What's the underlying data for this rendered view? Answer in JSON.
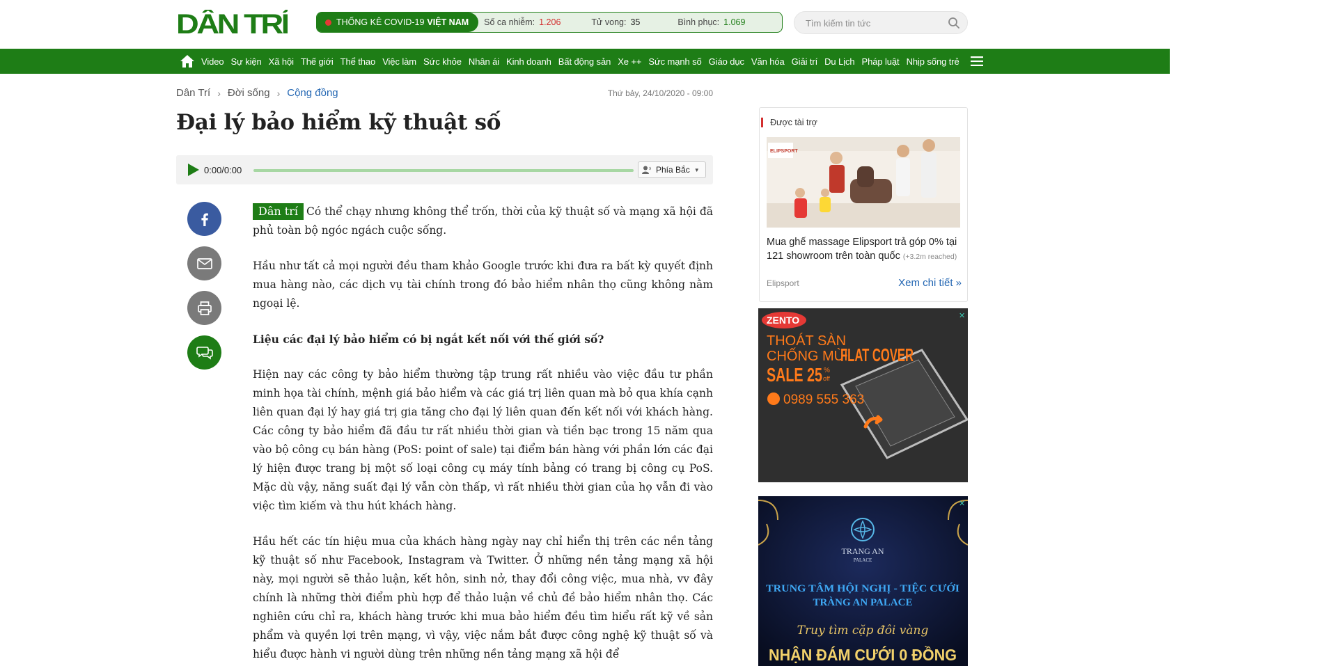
{
  "header": {
    "logo_text": "DÂN TRÍ",
    "covid": {
      "label": "THỐNG KÊ COVID-19",
      "country": "VIỆT NAM",
      "infected_label": "Số ca nhiễm:",
      "infected_value": "1.206",
      "deaths_label": "Tử vong:",
      "deaths_value": "35",
      "recovered_label": "Bình phục:",
      "recovered_value": "1.069",
      "infected_color": "#d32f2f",
      "recovered_color": "#1e7d16"
    },
    "search": {
      "placeholder": "Tìm kiếm tin tức"
    }
  },
  "nav": {
    "items": [
      "Video",
      "Sự kiện",
      "Xã hội",
      "Thế giới",
      "Thể thao",
      "Việc làm",
      "Sức khỏe",
      "Nhân ái",
      "Kinh doanh",
      "Bất động sản",
      "Xe ++",
      "Sức mạnh số",
      "Giáo dục",
      "Văn hóa",
      "Giải trí",
      "Du Lịch",
      "Pháp luật",
      "Nhịp sống trẻ"
    ],
    "bg_color": "#1e7d16"
  },
  "breadcrumb": [
    "Dân Trí",
    "Đời sống",
    "Cộng đồng"
  ],
  "date": "Thứ bảy, 24/10/2020 - 09:00",
  "title": "Đại lý bảo hiểm kỹ thuật số",
  "audio": {
    "time": "0:00/0:00",
    "voice": "Phía Bắc"
  },
  "share": {
    "icons": [
      "facebook-icon",
      "email-icon",
      "print-icon",
      "comment-icon"
    ]
  },
  "article": {
    "source_tag": "Dân trí",
    "lead": "Có thể chạy nhưng không thể trốn, thời của kỹ thuật số và mạng xã hội đã phủ toàn bộ ngóc ngách cuộc sống.",
    "p1": "Hầu như tất cả mọi người đều tham khảo Google trước khi đưa ra bất kỳ quyết định mua hàng nào, các dịch vụ tài chính trong đó bảo hiểm nhân thọ cũng không nằm ngoại lệ.",
    "subheading": "Liệu các đại lý bảo hiểm có bị ngắt kết nối với thế giới số?",
    "p2": "Hiện nay các công ty bảo hiểm thường tập trung rất nhiều vào việc đầu tư phần minh họa tài chính, mệnh giá bảo hiểm và các giá trị liên quan mà bỏ qua khía cạnh liên quan đại lý hay giá trị gia tăng cho đại lý liên quan đến kết nối với khách hàng. Các công ty bảo hiểm đã đầu tư rất nhiều thời gian và tiền bạc trong 15 năm qua vào bộ công cụ bán hàng (PoS: point of sale) tại điểm bán hàng với phần lớn các đại lý hiện được trang bị một số loại công cụ máy tính bảng có trang bị công cụ PoS. Mặc dù vậy, năng suất đại lý vẫn còn thấp, vì rất nhiều thời gian của họ vẫn đi vào việc tìm kiếm và thu hút khách hàng.",
    "p3": "Hầu hết các tín hiệu mua của khách hàng ngày nay chỉ hiển thị trên các nền tảng kỹ thuật số như Facebook, Instagram và Twitter. Ở những nền tảng mạng xã hội này, mọi người sẽ thảo luận, kết hôn, sinh nở, thay đổi công việc, mua nhà, vv đây chính là những thời điểm phù hợp để thảo luận về chủ đề bảo hiểm nhân thọ. Các nghiên cứu chỉ ra, khách hàng trước khi mua bảo hiểm đều tìm hiểu rất kỹ về sản phẩm và quyền lợi trên mạng, vì vậy, việc nắm bắt được công nghệ kỹ thuật số và hiểu được hành vi người dùng trên những nền tảng mạng xã hội để"
  },
  "sidebar": {
    "sponsored_label": "Được tài trợ",
    "sponsored_image_text": "ELIPSPORT",
    "sponsored_headline": "Mua ghế massage Elipsport trả góp 0% tại 121 showroom trên toàn quốc",
    "sponsored_reach": "(+3.2m reached)",
    "sponsored_source": "Elipsport",
    "sponsored_more": "Xem chi tiết »",
    "ad1": {
      "brand": "ZENTO",
      "line1": "THOÁT SÀN",
      "line2": "CHỐNG MÙI",
      "product": "FLAT COVER",
      "sale": "SALE 25",
      "sale_unit": "%",
      "sale_off": "off",
      "phone": "0989 555 363"
    },
    "ad2": {
      "brand": "TRANG AN",
      "brand_sub": "PALACE",
      "line1": "TRUNG TÂM HỘI NGHỊ - TIỆC CƯỚI",
      "line2": "TRÀNG AN PALACE",
      "script": "Truy tìm cặp đôi vàng",
      "headline": "NHẬN ĐÁM CƯỚI 0 ĐỒNG"
    }
  }
}
